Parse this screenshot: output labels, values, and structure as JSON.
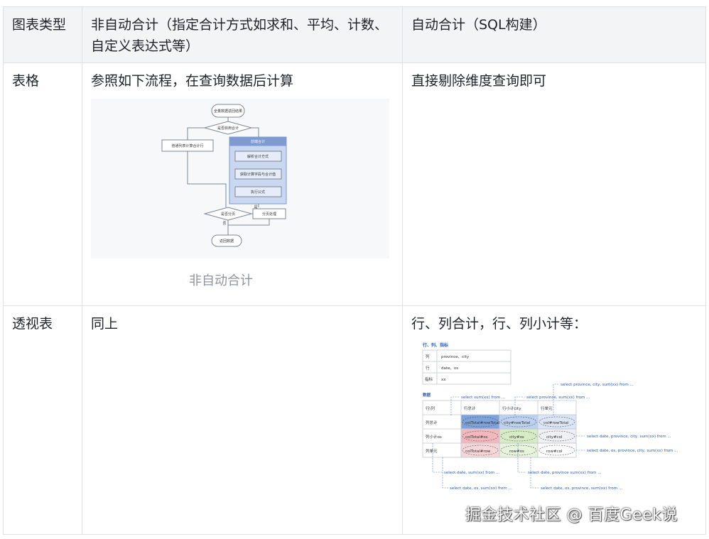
{
  "headers": {
    "chart_type": "图表类型",
    "manual": "非自动合计（指定合计方式如求和、平均、计数、自定义表达式等）",
    "auto": "自动合计（SQL构建）"
  },
  "rows": [
    {
      "type": "表格",
      "manual": "参照如下流程，在查询数据后计算",
      "manual_caption": "非自动合计",
      "auto": "直接剔除维度查询即可"
    },
    {
      "type": "透视表",
      "manual": "同上",
      "auto": "行、列合计，行、列小计等："
    }
  ],
  "flowchart": {
    "start": "全量数据返回结果",
    "decision1": "是否启用合计",
    "left_box": "普通列表计算合计行",
    "group_title": "前端合计",
    "step1": "解析合计方式",
    "step2": "获取计算字段与合计值",
    "step3": "执行公式",
    "decision2": "是否分页",
    "yes": "是",
    "no": "否",
    "right_box": "分页处理",
    "end": "返回数据"
  },
  "pivot_diagram": {
    "section1_title": "行、列、指标",
    "dims": [
      {
        "label": "列",
        "value": "province、city"
      },
      {
        "label": "行",
        "value": "date、os"
      },
      {
        "label": "指标",
        "value": "xx"
      }
    ],
    "section2_title": "数据",
    "grid_headers": [
      "行\\列",
      "行总计",
      "行小计city",
      "行单元"
    ],
    "grid_rows": [
      {
        "label": "列总计",
        "cells": [
          "colTotal#rowTotal",
          "city#rowTotal",
          "col#rowTotal"
        ]
      },
      {
        "label": "列小计os",
        "cells": [
          "colTotal#os",
          "city#os",
          "city#col"
        ]
      },
      {
        "label": "列单元",
        "cells": [
          "colTotal#row",
          "row#os",
          "row#col"
        ]
      }
    ],
    "queries": {
      "q1": "select sum(xx) from ...",
      "q2": "select province, sum(xx) from ...",
      "q3": "select province, city, sum(xx) from ...",
      "q4": "select date, province, city, sum(xx) from ...",
      "q5": "select date, os, province, city, sum(xx) from ...",
      "q6": "select date, sum(xx) from ...",
      "q7": "select date, province sum(xx) from ...",
      "q8": "select date, os, sum(xx) from ...",
      "q9": "select date, os, province, sum(xx) from ..."
    }
  },
  "watermark": "掘金技术社区 @ 百度Geek说"
}
